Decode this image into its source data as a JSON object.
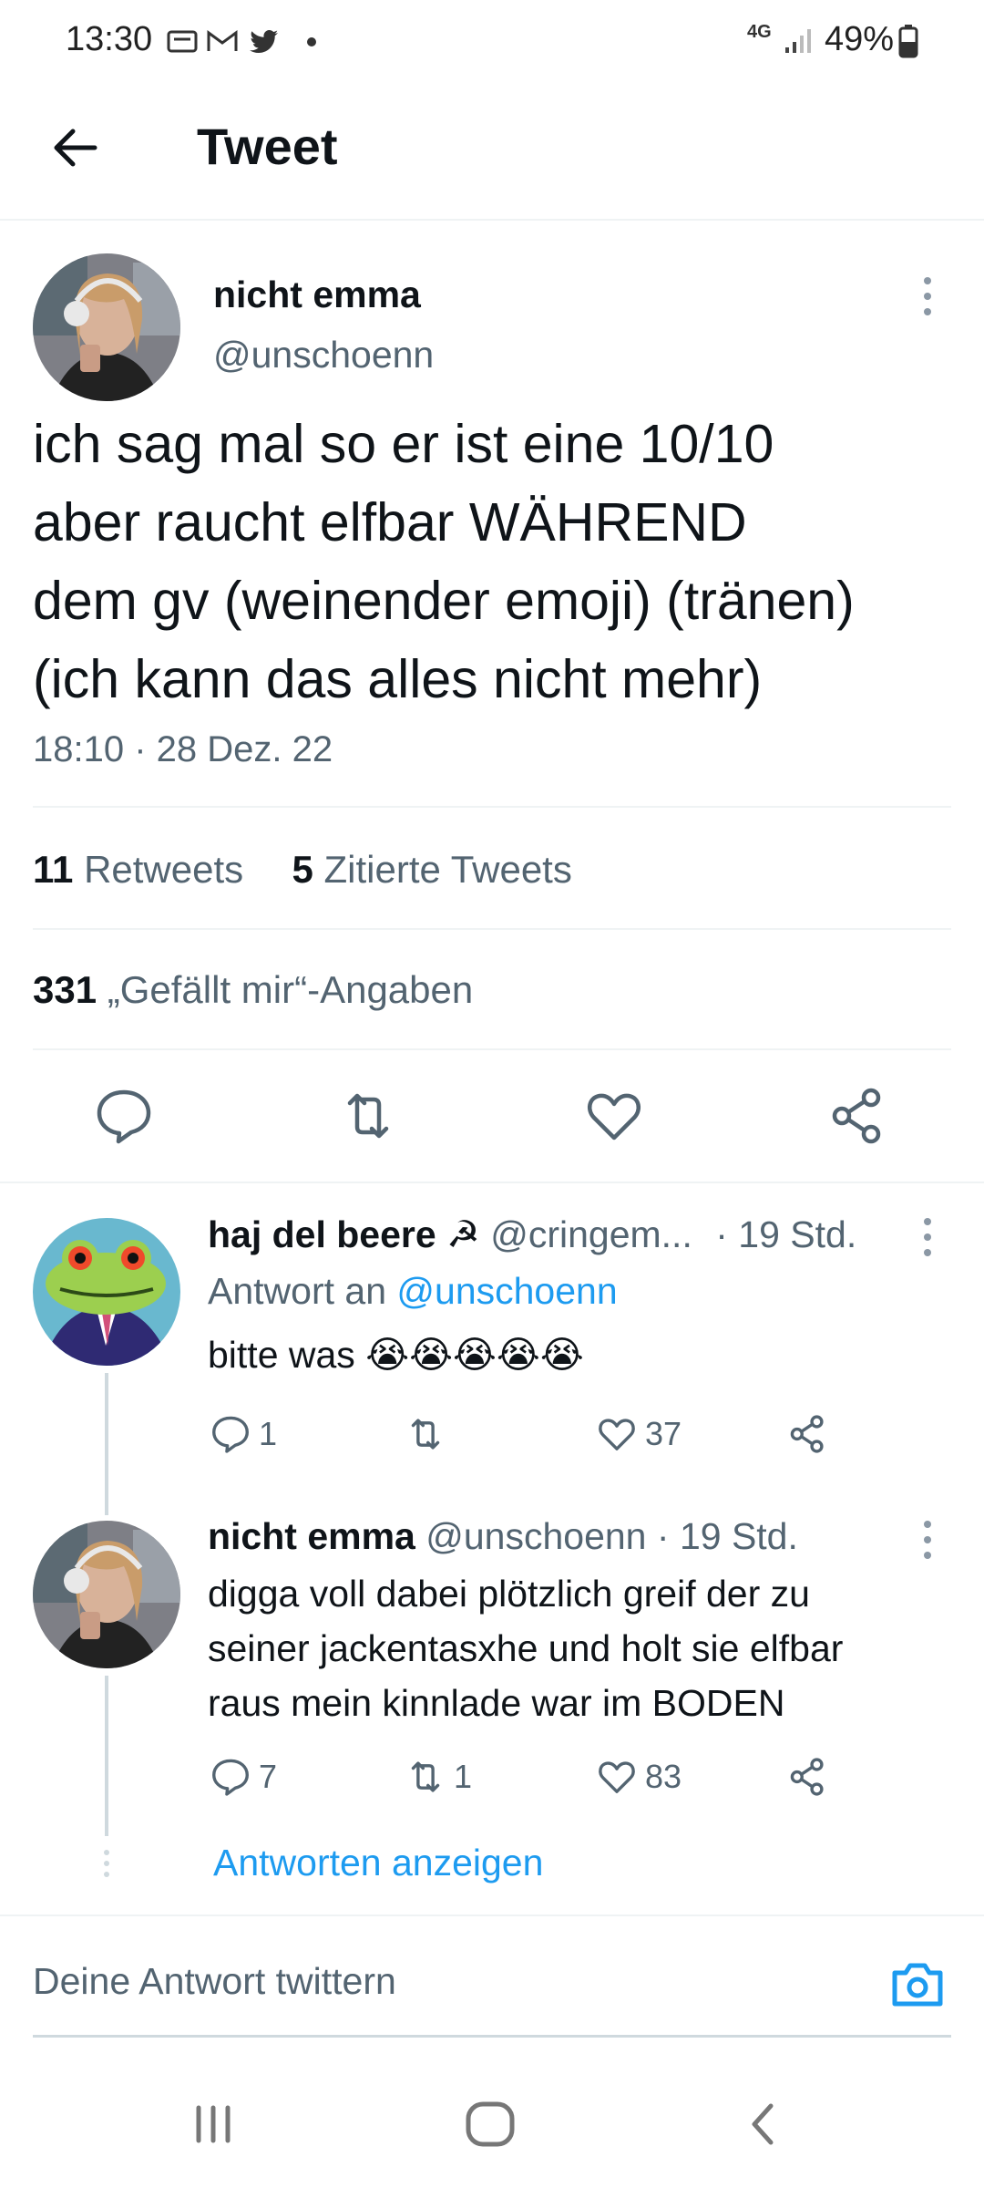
{
  "status_bar": {
    "time": "13:30",
    "battery": "49%",
    "network": "4G"
  },
  "header": {
    "title": "Tweet"
  },
  "main_tweet": {
    "author_name": "nicht emma",
    "author_handle": "@unschoenn",
    "text_lines": [
      "ich sag mal so er ist eine 10/10",
      "aber raucht elfbar WÄHREND",
      "dem gv (weinender emoji) (tränen)",
      "(ich kann das alles nicht mehr)"
    ],
    "timestamp": "18:10 · 28 Dez. 22",
    "retweets_count": "11",
    "retweets_label": "Retweets",
    "quotes_count": "5",
    "quotes_label": "Zitierte Tweets",
    "likes_count": "331",
    "likes_label": "„Gefällt mir“-Angaben"
  },
  "replies": [
    {
      "author_name": "haj del beere ☭",
      "author_handle": "@cringem...",
      "time": "· 19 Std.",
      "reply_to_prefix": "Antwort an",
      "reply_to_handle": "@unschoenn",
      "text_lines": [
        "bitte was 😭😭😭😭😭"
      ],
      "reply_count": "1",
      "retweet_count": "",
      "like_count": "37"
    },
    {
      "author_name": "nicht emma",
      "author_handle": "@unschoenn",
      "time": "· 19 Std.",
      "text_lines": [
        "digga voll dabei plötzlich greif der zu",
        "seiner jackentasxhe und holt sie elfbar",
        "raus mein kinnlade war im BODEN"
      ],
      "reply_count": "7",
      "retweet_count": "1",
      "like_count": "83"
    }
  ],
  "show_replies_link": "Antworten anzeigen",
  "reply_box": {
    "placeholder": "Deine Antwort twittern"
  },
  "colors": {
    "accent": "#1d9bf0",
    "text": "#0f1419",
    "muted": "#536471",
    "divider": "#eff3f4"
  }
}
